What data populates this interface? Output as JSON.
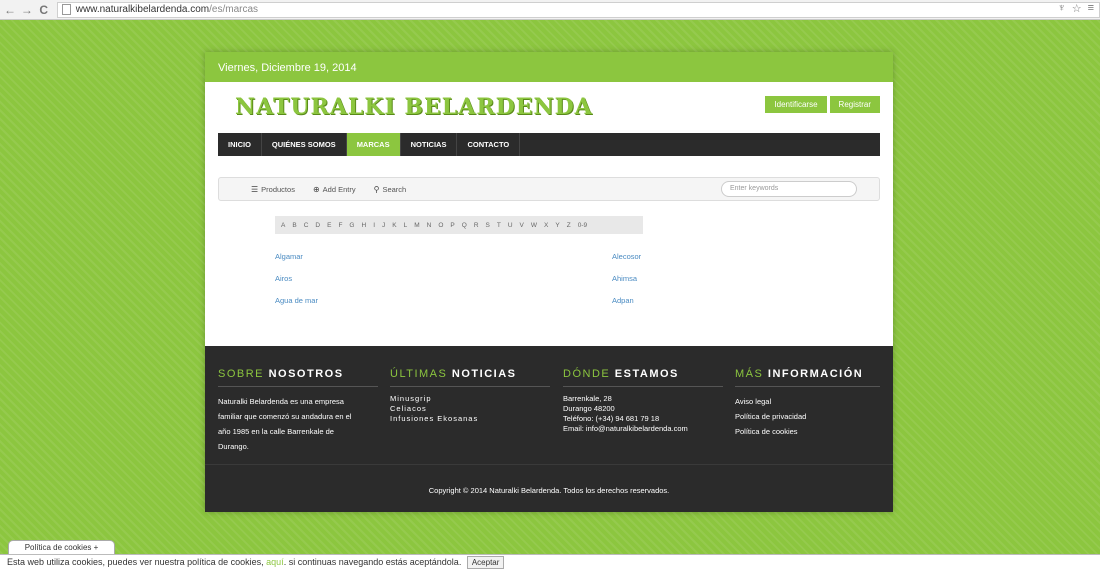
{
  "browser": {
    "url_domain": "www.naturalkibelardenda.com",
    "url_path": "/es/marcas",
    "back_icon": "←",
    "forward_icon": "→",
    "reload_icon": "C",
    "ext_icon": "♆",
    "star_icon": "☆",
    "menu_icon": "≡"
  },
  "site": {
    "date": "Viernes, Diciembre 19, 2014",
    "logo": "NATURALKI BELARDENDA",
    "login_label": "Identificarse",
    "register_label": "Registrar",
    "accent_color": "#8cc63f"
  },
  "nav": {
    "items": [
      {
        "label": "INICIO"
      },
      {
        "label": "QUIÉNES SOMOS"
      },
      {
        "label": "MARCAS",
        "active": true
      },
      {
        "label": "NOTICIAS"
      },
      {
        "label": "CONTACTO"
      }
    ]
  },
  "toolbar": {
    "products_icon": "☰",
    "products_label": "Productos",
    "add_icon": "⊕",
    "add_label": "Add Entry",
    "search_icon": "⚲",
    "search_label": "Search",
    "keywords_placeholder": "Enter keywords"
  },
  "alphabet": [
    "A",
    "B",
    "C",
    "D",
    "E",
    "F",
    "G",
    "H",
    "I",
    "J",
    "K",
    "L",
    "M",
    "N",
    "O",
    "P",
    "Q",
    "R",
    "S",
    "T",
    "U",
    "V",
    "W",
    "X",
    "Y",
    "Z",
    "0-9"
  ],
  "brands": {
    "left": [
      "Algamar",
      "Airos",
      "Agua de mar"
    ],
    "right": [
      "Alecosor",
      "Ahimsa",
      "Adpan"
    ]
  },
  "footer": {
    "about": {
      "title_accent": "SOBRE",
      "title_rest": "NOSOTROS",
      "text": [
        "Naturalki Belardenda es una empresa",
        "familiar que comenzó su andadura  en el",
        "año 1985 en la calle Barrenkale de",
        "Durango."
      ]
    },
    "news": {
      "title_accent": "ÚLTIMAS",
      "title_rest": "NOTICIAS",
      "items": [
        "Minusgrip",
        "Celiacos",
        "Infusiones Ekosanas"
      ]
    },
    "location": {
      "title_accent": "DÓNDE",
      "title_rest": "ESTAMOS",
      "lines": [
        "Barrenkale, 28",
        "Durango 48200",
        "Teléfono: (+34) 94 681 79 18",
        "Email: info@naturalkibelardenda.com"
      ]
    },
    "info": {
      "title_accent": "MÁS",
      "title_rest": "INFORMACIÓN",
      "links": [
        "Aviso legal",
        "Política de privacidad",
        "Política de cookies"
      ]
    },
    "copyright": "Copyright © 2014 Naturalki Belardenda. Todos los derechos reservados."
  },
  "cookies": {
    "tab_label": "Política de cookies +",
    "text_before": "Esta web utiliza cookies, puedes ver nuestra política de cookies, ",
    "link": "aquí",
    "text_after": ". si continuas navegando estás aceptándola.",
    "accept_label": "Aceptar"
  }
}
